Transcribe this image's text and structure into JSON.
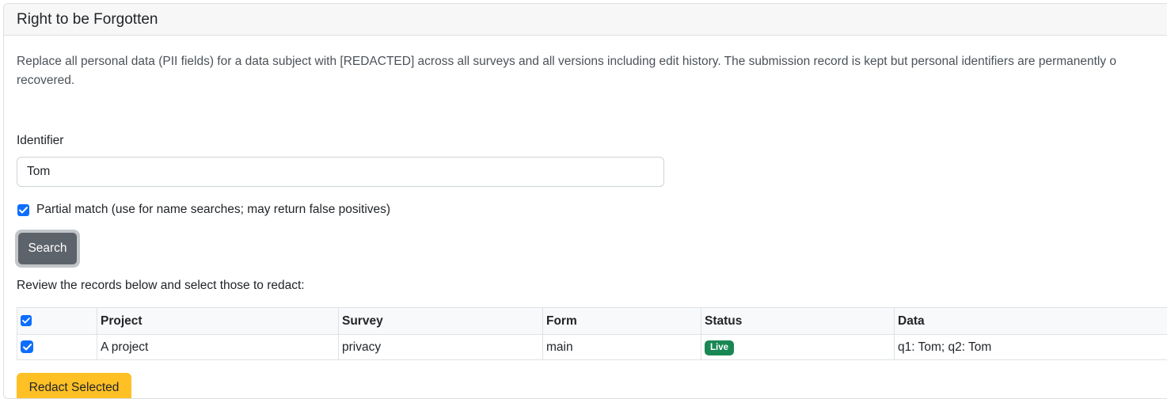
{
  "card": {
    "title": "Right to be Forgotten"
  },
  "description": "Replace all personal data (PII fields) for a data subject with [REDACTED] across all surveys and all versions including edit history. The submission record is kept but personal identifiers are permanently o recovered.",
  "form": {
    "identifier_label": "Identifier",
    "identifier_value": "Tom",
    "partial_match_checked": true,
    "partial_match_label": "Partial match (use for name searches; may return false positives)",
    "search_label": "Search"
  },
  "review_text": "Review the records below and select those to redact:",
  "table": {
    "headers": [
      "Project",
      "Survey",
      "Form",
      "Status",
      "Data"
    ],
    "rows": [
      {
        "checked": true,
        "project": "A project",
        "survey": "privacy",
        "form": "main",
        "status": "Live",
        "data": "q1: Tom; q2: Tom"
      }
    ]
  },
  "redact_label": "Redact Selected",
  "colors": {
    "primary": "#0d6efd",
    "secondary": "#5c636a",
    "success": "#198754",
    "warning": "#ffc025"
  }
}
